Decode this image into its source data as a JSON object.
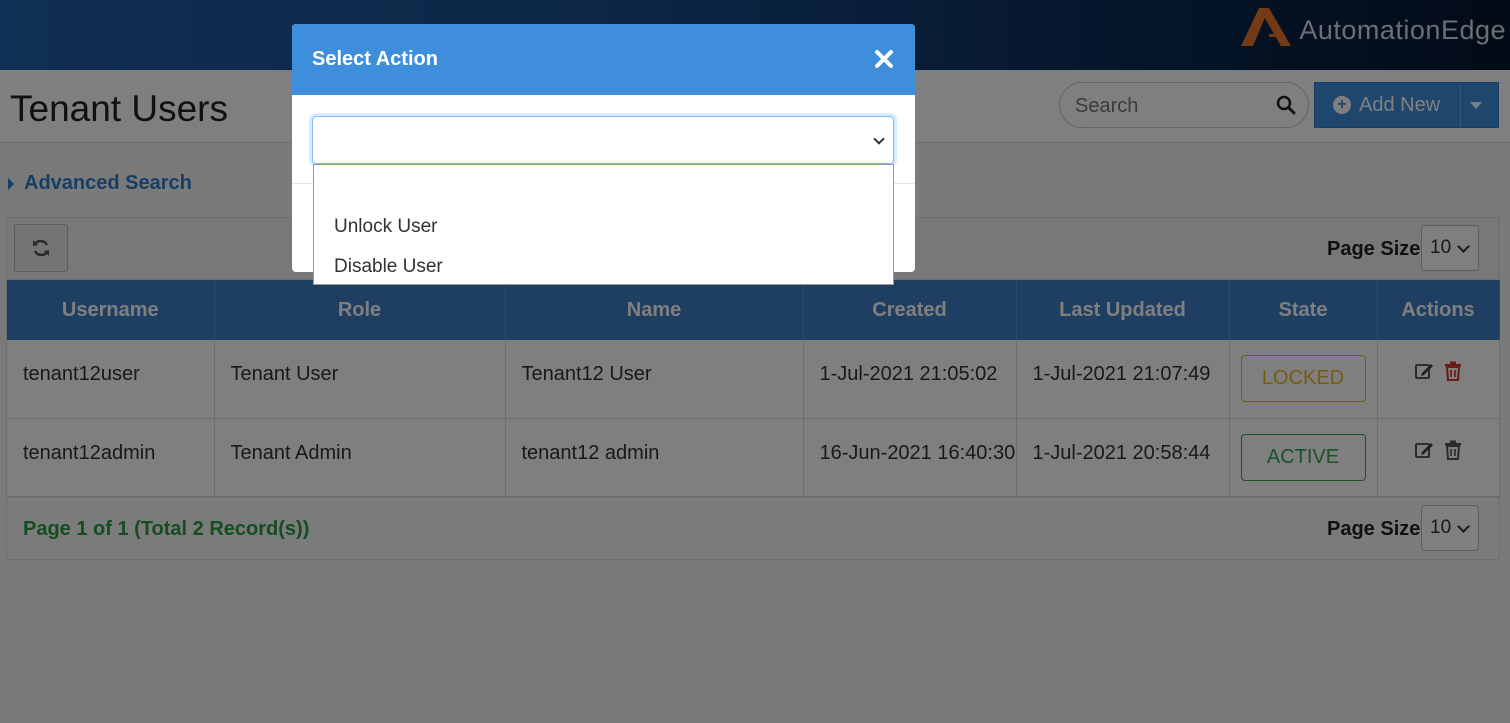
{
  "header": {
    "logo_text": "AutomationEdge",
    "brand_color": "#1f5fa8"
  },
  "page": {
    "title": "Tenant Users",
    "search_placeholder": "Search",
    "add_new_label": "Add New",
    "advanced_search_label": "Advanced Search"
  },
  "grid": {
    "page_size_label": "Page Size",
    "page_size_value": "10",
    "columns": [
      "Username",
      "Role",
      "Name",
      "Created",
      "Last Updated",
      "State",
      "Actions"
    ],
    "rows": [
      {
        "username": "tenant12user",
        "role": "Tenant User",
        "name": "Tenant12 User",
        "created": "1-Jul-2021 21:05:02",
        "last_updated": "1-Jul-2021 21:07:49",
        "state": "LOCKED",
        "state_color": "#e8b923",
        "delete_icon_color": "#d9342b"
      },
      {
        "username": "tenant12admin",
        "role": "Tenant Admin",
        "name": "tenant12 admin",
        "created": "16-Jun-2021 16:40:30",
        "last_updated": "1-Jul-2021 20:58:44",
        "state": "ACTIVE",
        "state_color": "#3aa353",
        "delete_icon_color": "#555555"
      }
    ],
    "page_info": "Page 1 of 1 (Total 2 Record(s))"
  },
  "modal": {
    "title": "Select Action",
    "selected_value": "",
    "options": [
      "",
      "Unlock User",
      "Disable User"
    ]
  }
}
